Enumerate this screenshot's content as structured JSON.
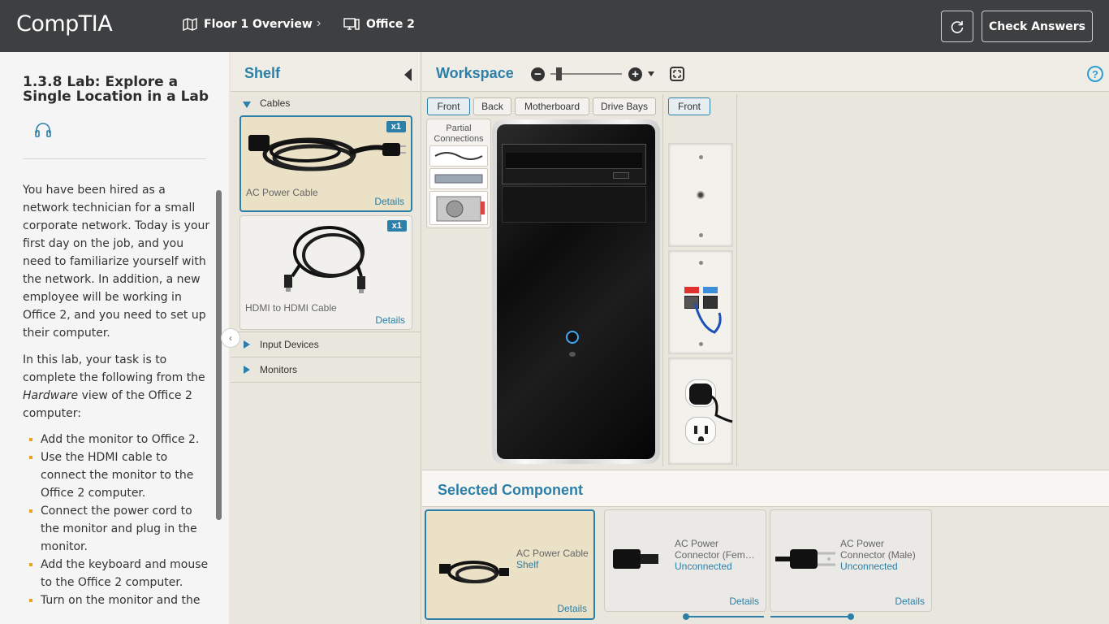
{
  "app": {
    "logo": "CompTIA",
    "breadcrumb": [
      {
        "label": "Floor 1 Overview",
        "icon": "map-icon"
      },
      {
        "label": "Office 2",
        "icon": "computer-icon"
      }
    ],
    "breadcrumb_separator": "›",
    "reset_icon": "reset-icon",
    "check_answers_label": "Check Answers"
  },
  "instructions": {
    "title": "1.3.8 Lab: Explore a Single Location in a Lab",
    "audio_icon": "headphones-icon",
    "para1": "You have been hired as a network technician for a small corporate network. Today is your first day on the job, and you need to familiarize yourself with the network. In addition, a new employee will be working in Office 2, and you need to set up their computer.",
    "para2_before": "In this lab, your task is to complete the following from the ",
    "para2_em": "Hardware",
    "para2_after": " view of the Office 2 computer:",
    "tasks": [
      "Add the monitor to Office 2.",
      "Use the HDMI cable to connect the monitor to the Office 2 computer.",
      "Connect the power cord to the monitor and plug in the monitor.",
      "Add the keyboard and mouse to the Office 2 computer.",
      "Turn on the monitor and the"
    ]
  },
  "shelf": {
    "title": "Shelf",
    "categories": [
      {
        "label": "Cables",
        "expanded": true
      },
      {
        "label": "Input Devices",
        "expanded": false
      },
      {
        "label": "Monitors",
        "expanded": false
      }
    ],
    "items": [
      {
        "name": "AC Power Cable",
        "badge": "x1",
        "details": "Details",
        "selected": true
      },
      {
        "name": "HDMI to HDMI Cable",
        "badge": "x1",
        "details": "Details",
        "selected": false
      }
    ]
  },
  "workspace": {
    "title": "Workspace",
    "view_tabs": [
      "Front",
      "Back",
      "Motherboard",
      "Drive Bays"
    ],
    "active_view": "Front",
    "wall_tab": "Front",
    "partial_connections_label": "Partial Connections",
    "zoom_minus": "−",
    "zoom_plus": "+",
    "help": "?"
  },
  "selected_component": {
    "title": "Selected Component",
    "cards": [
      {
        "name": "AC Power Cable",
        "status": "Shelf",
        "details": "Details"
      },
      {
        "name": "AC Power Connector (Fem…",
        "status": "Unconnected",
        "details": "Details"
      },
      {
        "name": "AC Power Connector (Male)",
        "status": "Unconnected",
        "details": "Details"
      }
    ]
  },
  "colors": {
    "accent": "#2b7fa8",
    "topbar": "#3e3f40",
    "bullet": "#e8a317"
  }
}
